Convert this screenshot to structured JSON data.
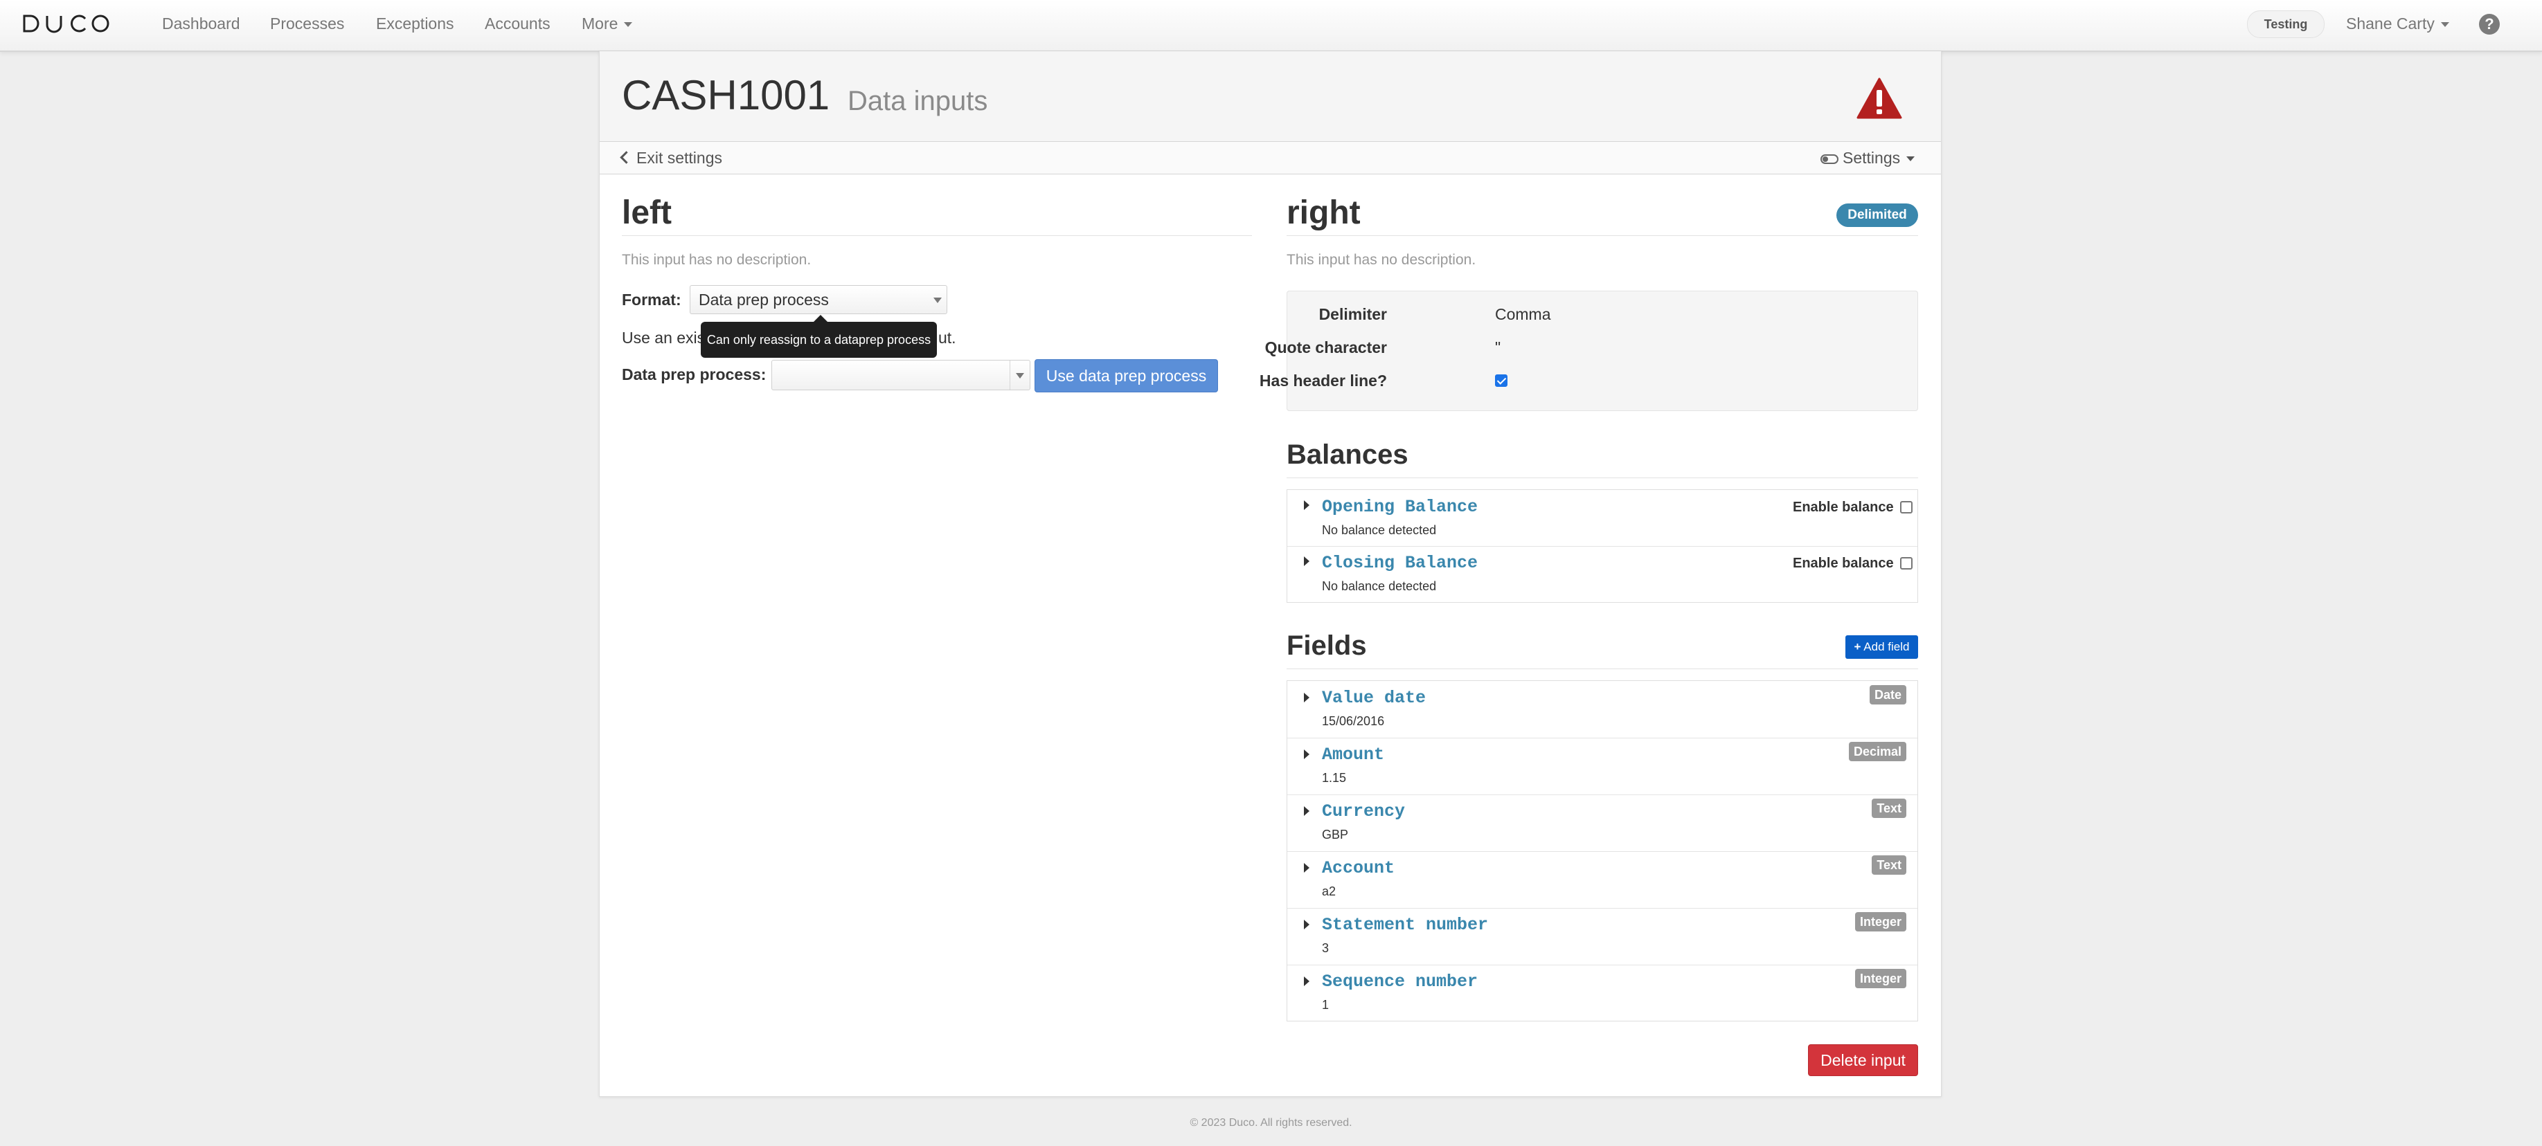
{
  "nav": {
    "items": [
      "Dashboard",
      "Processes",
      "Exceptions",
      "Accounts"
    ],
    "more_label": "More",
    "environment": "Testing",
    "user": "Shane Carty",
    "help_glyph": "?"
  },
  "header": {
    "title": "CASH1001",
    "subtitle": "Data inputs",
    "exit_label": "Exit settings",
    "settings_label": "Settings"
  },
  "left": {
    "title": "left",
    "description": "This input has no description.",
    "format_label": "Format:",
    "format_value": "Data prep process",
    "tooltip": "Can only reassign to a dataprep process",
    "use_text_start": "Use an exis",
    "use_text_end": "ut.",
    "dp_label": "Data prep process:",
    "dp_value": "",
    "use_button": "Use data prep process"
  },
  "right": {
    "title": "right",
    "badge": "Delimited",
    "description": "This input has no description.",
    "delimiter_label": "Delimiter",
    "delimiter_value": "Comma",
    "quote_label": "Quote character",
    "quote_value": "\"",
    "header_label": "Has header line?",
    "header_checked": true
  },
  "balances": {
    "title": "Balances",
    "enable_label": "Enable balance",
    "items": [
      {
        "name": "Opening Balance",
        "status": "No balance detected",
        "enabled": false
      },
      {
        "name": "Closing Balance",
        "status": "No balance detected",
        "enabled": false
      }
    ]
  },
  "fields": {
    "title": "Fields",
    "add_label": "Add field",
    "items": [
      {
        "name": "Value date",
        "value": "15/06/2016",
        "type": "Date"
      },
      {
        "name": "Amount",
        "value": "1.15",
        "type": "Decimal"
      },
      {
        "name": "Currency",
        "value": "GBP",
        "type": "Text"
      },
      {
        "name": "Account",
        "value": "a2",
        "type": "Text"
      },
      {
        "name": "Statement number",
        "value": "3",
        "type": "Integer"
      },
      {
        "name": "Sequence number",
        "value": "1",
        "type": "Integer"
      }
    ]
  },
  "delete_label": "Delete input",
  "footer": "© 2023 Duco. All rights reserved.",
  "colors": {
    "link_blue": "#3a87ad",
    "primary_button": "#5b8fd8",
    "danger_button": "#d3343b",
    "warning_red": "#b3201f",
    "add_button": "#0a5fc7"
  }
}
